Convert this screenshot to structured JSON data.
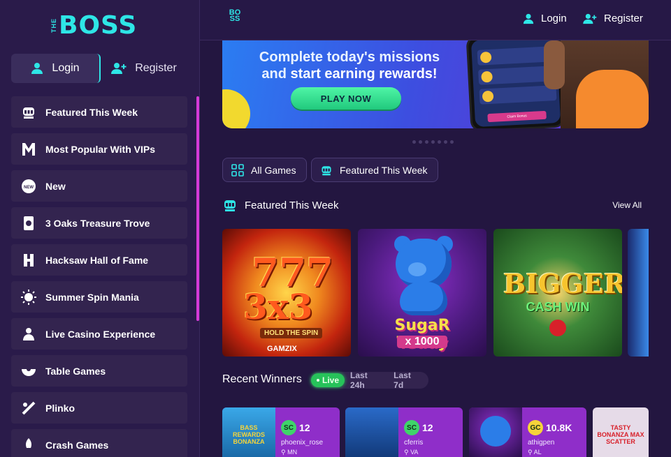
{
  "brand": {
    "logo_the": "THE",
    "logo_boss": "BOSS",
    "small_logo_top": "BO",
    "small_logo_bottom": "SS"
  },
  "sidebar": {
    "login_label": "Login",
    "register_label": "Register",
    "items": [
      {
        "label": "Featured This Week",
        "icon": "slot-machine-icon"
      },
      {
        "label": "Most Popular With VIPs",
        "icon": "m-letter-icon"
      },
      {
        "label": "New",
        "icon": "new-badge-icon"
      },
      {
        "label": "3 Oaks Treasure Trove",
        "icon": "oak-icon"
      },
      {
        "label": "Hacksaw Hall of Fame",
        "icon": "hacksaw-icon"
      },
      {
        "label": "Summer Spin Mania",
        "icon": "sun-icon"
      },
      {
        "label": "Live Casino Experience",
        "icon": "dealer-icon"
      },
      {
        "label": "Table Games",
        "icon": "roulette-icon"
      },
      {
        "label": "Plinko",
        "icon": "plinko-icon"
      },
      {
        "label": "Crash Games",
        "icon": "rocket-icon"
      }
    ]
  },
  "topbar": {
    "login_label": "Login",
    "register_label": "Register"
  },
  "banner": {
    "line1": "Complete today's missions",
    "line2_prefix": "and ",
    "line2_bold": "start earning rewards!",
    "cta": "PLAY NOW",
    "phone_claim": "Claim Bonus"
  },
  "filters": [
    {
      "label": "All Games",
      "icon": "grid-icon"
    },
    {
      "label": "Featured This Week",
      "icon": "slot-machine-icon"
    }
  ],
  "featured": {
    "title": "Featured This Week",
    "view_all": "View All",
    "games": [
      {
        "line1": "777",
        "line2": "3x3",
        "sub": "HOLD THE SPIN",
        "brand": "GAMZIX"
      },
      {
        "title": "SugaR Teddy",
        "mult": "x 1000"
      },
      {
        "line1": "BIGGER",
        "line2": "CASH WIN"
      }
    ]
  },
  "winners": {
    "title": "Recent Winners",
    "tabs": [
      "Live",
      "Last 24h",
      "Last 7d"
    ],
    "active_tab": "Live",
    "items": [
      {
        "currency": "SC",
        "amount": "12",
        "user": "phoenix_rose",
        "state": "MN",
        "game": "BASS REWARDS BONANZA",
        "badge_color": "#3fd46a"
      },
      {
        "currency": "SC",
        "amount": "12",
        "user": "cferris",
        "state": "VA",
        "game": "",
        "badge_color": "#3fd46a"
      },
      {
        "currency": "GC",
        "amount": "10.8K",
        "user": "athigpen",
        "state": "AL",
        "game": "",
        "badge_color": "#f5d43a"
      },
      {
        "currency": "",
        "amount": "",
        "user": "",
        "state": "",
        "game": "TASTY BONANZA MAX SCATTER",
        "badge_color": ""
      }
    ]
  },
  "colors": {
    "accent": "#2ee6e6",
    "scroll": "#d63ad8",
    "live": "#27c25a",
    "winner_card": "#8f2ec9"
  }
}
